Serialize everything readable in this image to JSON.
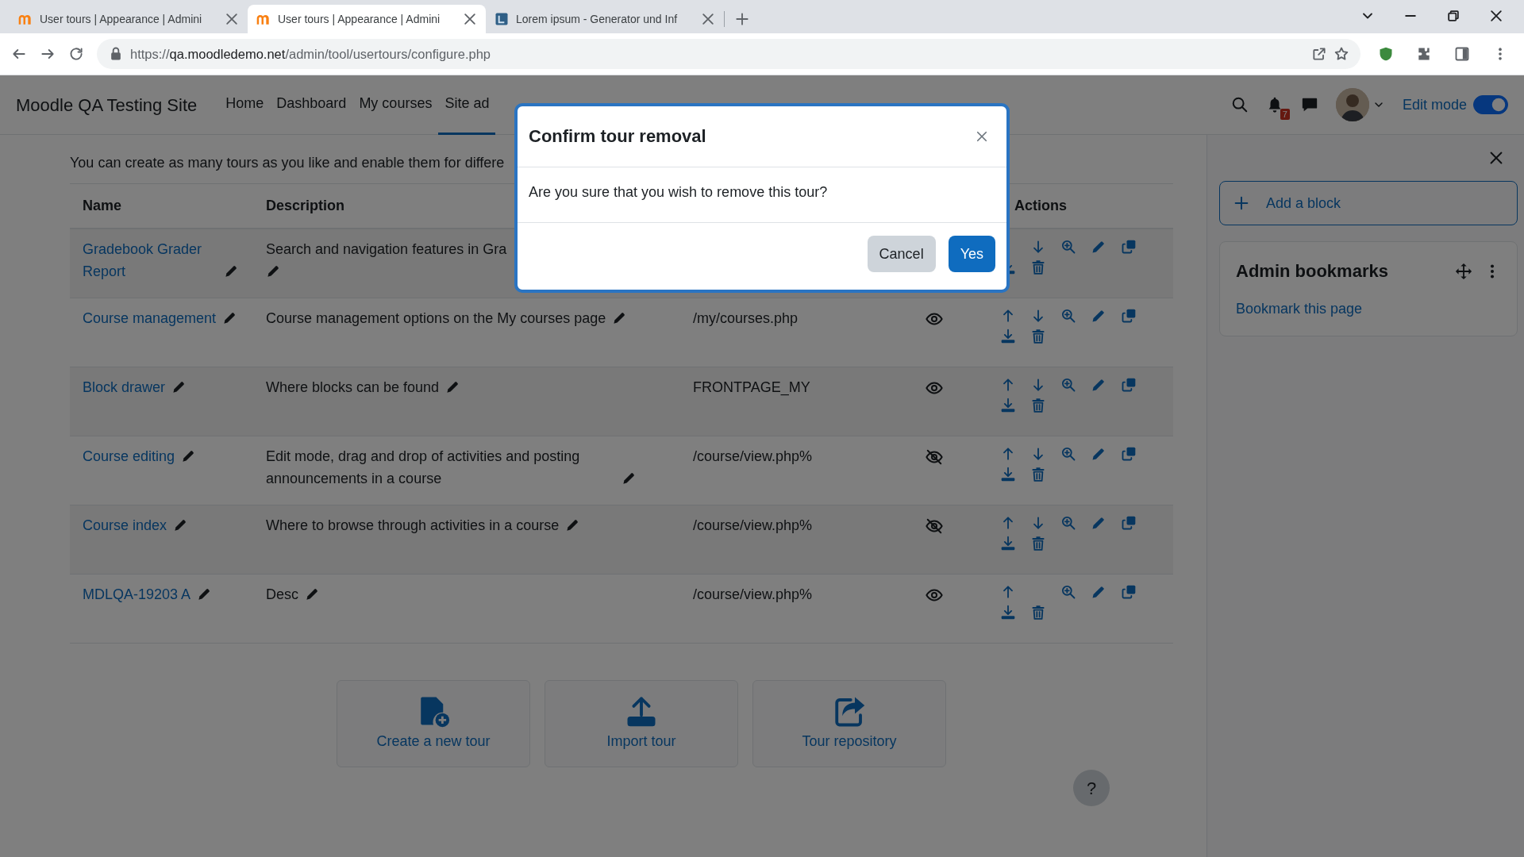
{
  "browser": {
    "tabs": [
      {
        "title": "User tours | Appearance | Admini",
        "selected": false,
        "kind": "moodle"
      },
      {
        "title": "User tours | Appearance | Admini",
        "selected": true,
        "kind": "moodle"
      },
      {
        "title": "Lorem ipsum - Generator und Inf",
        "selected": false,
        "kind": "lorem"
      }
    ],
    "url_host": "qa.moodledemo.net",
    "url_path": "/admin/tool/usertours/configure.php",
    "url_scheme": "https://"
  },
  "navbar": {
    "site_name": "Moodle QA Testing Site",
    "links": [
      {
        "label": "Home",
        "selected": false
      },
      {
        "label": "Dashboard",
        "selected": false
      },
      {
        "label": "My courses",
        "selected": false
      },
      {
        "label": "Site ad",
        "selected": true
      }
    ],
    "notification_count": "7",
    "edit_mode": {
      "label": "Edit mode",
      "on": true
    }
  },
  "intro": "You can create as many tours as you like and enable them for differe",
  "table": {
    "columns": [
      "Name",
      "Description",
      "Actions"
    ],
    "rows": [
      {
        "name": "Gradebook Grader Report",
        "description": "Search and navigation features in Gra",
        "truncated": true,
        "actions": [
          {
            "kind": "down"
          },
          {
            "kind": "view"
          },
          {
            "kind": "edit"
          },
          {
            "kind": "duplicate"
          },
          {
            "kind": "export"
          },
          {
            "kind": "delete"
          }
        ]
      },
      {
        "name": "Course management",
        "description": "Course management options on the My courses page",
        "path": "/my/courses.php",
        "enabled": true,
        "actions": [
          {
            "kind": "up"
          },
          {
            "kind": "down"
          },
          {
            "kind": "view"
          },
          {
            "kind": "edit"
          },
          {
            "kind": "duplicate"
          },
          {
            "kind": "export"
          },
          {
            "kind": "delete"
          }
        ]
      },
      {
        "name": "Block drawer",
        "description": "Where blocks can be found",
        "path": "FRONTPAGE_MY",
        "enabled": true,
        "actions": [
          {
            "kind": "up"
          },
          {
            "kind": "down"
          },
          {
            "kind": "view"
          },
          {
            "kind": "edit"
          },
          {
            "kind": "duplicate"
          },
          {
            "kind": "export"
          },
          {
            "kind": "delete"
          }
        ]
      },
      {
        "name": "Course editing",
        "description": "Edit mode, drag and drop of activities and posting announcements in a course",
        "path": "/course/view.php%",
        "enabled": false,
        "actions": [
          {
            "kind": "up"
          },
          {
            "kind": "down"
          },
          {
            "kind": "view"
          },
          {
            "kind": "edit"
          },
          {
            "kind": "duplicate"
          },
          {
            "kind": "export"
          },
          {
            "kind": "delete"
          }
        ]
      },
      {
        "name": "Course index",
        "description": "Where to browse through activities in a course",
        "path": "/course/view.php%",
        "enabled": false,
        "actions": [
          {
            "kind": "up"
          },
          {
            "kind": "down"
          },
          {
            "kind": "view"
          },
          {
            "kind": "edit"
          },
          {
            "kind": "duplicate"
          },
          {
            "kind": "export"
          },
          {
            "kind": "delete"
          }
        ]
      },
      {
        "name": "MDLQA-19203 A",
        "description": "Desc",
        "path": "/course/view.php%",
        "enabled": true,
        "actions": [
          {
            "kind": "up"
          },
          {
            "kind": "view"
          },
          {
            "kind": "edit"
          },
          {
            "kind": "duplicate"
          },
          {
            "kind": "export"
          },
          {
            "kind": "delete"
          }
        ]
      }
    ]
  },
  "buttons": [
    {
      "label": "Create a new tour",
      "kind": "create"
    },
    {
      "label": "Import tour",
      "kind": "import"
    },
    {
      "label": "Tour repository",
      "kind": "repository"
    }
  ],
  "drawer": {
    "add_block": "Add a block",
    "block": {
      "title": "Admin bookmarks",
      "link": "Bookmark this page"
    }
  },
  "help": "?",
  "modal": {
    "title": "Confirm tour removal",
    "message": "Are you sure that you wish to remove this tour?",
    "buttons": [
      {
        "label": "Cancel",
        "kind": "secondary"
      },
      {
        "label": "Yes",
        "kind": "primary"
      }
    ]
  }
}
